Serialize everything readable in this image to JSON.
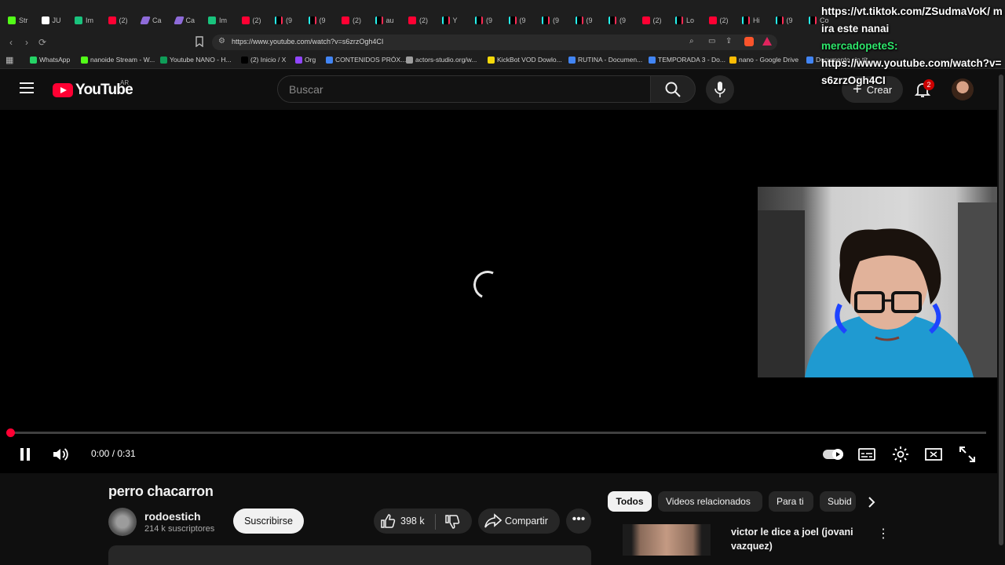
{
  "browser": {
    "tabs": [
      {
        "label": "Str",
        "icon": "kick-icon"
      },
      {
        "label": "JU",
        "icon": "google-icon"
      },
      {
        "label": "Im",
        "icon": "chatgpt-icon"
      },
      {
        "label": "(2)",
        "icon": "youtube-icon"
      },
      {
        "label": "Ca",
        "icon": "claude-icon"
      },
      {
        "label": "Ca",
        "icon": "claude-icon"
      },
      {
        "label": "Im",
        "icon": "chatgpt-icon"
      },
      {
        "label": "(2)",
        "icon": "youtube-icon"
      },
      {
        "label": "(9",
        "icon": "tiktok-icon"
      },
      {
        "label": "(9",
        "icon": "tiktok-icon"
      },
      {
        "label": "(2)",
        "icon": "youtube-icon"
      },
      {
        "label": "au",
        "icon": "tiktok-icon"
      },
      {
        "label": "(2)",
        "icon": "youtube-icon"
      },
      {
        "label": "Y",
        "icon": "tiktok-icon"
      },
      {
        "label": "(9",
        "icon": "tiktok-icon"
      },
      {
        "label": "(9",
        "icon": "tiktok-icon"
      },
      {
        "label": "(9",
        "icon": "tiktok-icon"
      },
      {
        "label": "(9",
        "icon": "tiktok-icon"
      },
      {
        "label": "(9",
        "icon": "tiktok-icon"
      },
      {
        "label": "(2)",
        "icon": "youtube-icon"
      },
      {
        "label": "Lo",
        "icon": "tiktok-icon"
      },
      {
        "label": "(2)",
        "icon": "youtube-icon"
      },
      {
        "label": "Hi",
        "icon": "tiktok-icon"
      },
      {
        "label": "(9",
        "icon": "tiktok-icon"
      },
      {
        "label": "Co",
        "icon": "tiktok-icon"
      }
    ],
    "url": "https://www.youtube.com/watch?v=s6zrzOgh4CI",
    "bookmarks": [
      {
        "label": "WhatsApp",
        "color": "#25d366"
      },
      {
        "label": "nanoide Stream - W...",
        "color": "#53fc18"
      },
      {
        "label": "Youtube NANO - H...",
        "color": "#0f9d58"
      },
      {
        "label": "(2) Inicio / X",
        "color": "#000000"
      },
      {
        "label": "Org",
        "color": "#9146ff"
      },
      {
        "label": "CONTENIDOS PRÓX...",
        "color": "#4285f4"
      },
      {
        "label": "actors-studio.org/w...",
        "color": "#9e9e9e"
      },
      {
        "label": "KickBot VOD Dowlo...",
        "color": "#f5d90a"
      },
      {
        "label": "RUTINA - Documen...",
        "color": "#4285f4"
      },
      {
        "label": "TEMPORADA 3 - Do...",
        "color": "#4285f4"
      },
      {
        "label": "nano - Google Drive",
        "color": "#fbbc04"
      },
      {
        "label": "Documento sin tít...",
        "color": "#4285f4"
      }
    ]
  },
  "youtube": {
    "logo_text": "YouTube",
    "country_code": "AR",
    "search_placeholder": "Buscar",
    "create_label": "Crear",
    "notification_count": "2"
  },
  "player": {
    "time": "0:00 / 0:31",
    "progress": 0.0,
    "state": "loading"
  },
  "chat": {
    "line1": "https://vt.tiktok.com/ZSudmaVoK/ mira este nanai",
    "username": "mercadopeteS:",
    "line2": "https://www.youtube.com/watch?v=s6zrzOgh4CI"
  },
  "video": {
    "title": "perro chacarron",
    "channel_name": "rodoestich",
    "subscribers": "214 k suscriptores",
    "subscribe_label": "Suscribirse",
    "likes": "398 k",
    "share_label": "Compartir"
  },
  "related": {
    "chips": [
      "Todos",
      "Videos relacionados",
      "Para ti",
      "Subid"
    ],
    "first_title": "victor le dice a joel (jovani vazquez)"
  },
  "colors": {
    "accent": "#ff0033",
    "background": "#0f0f0f",
    "chat_user": "#2ee66b"
  }
}
